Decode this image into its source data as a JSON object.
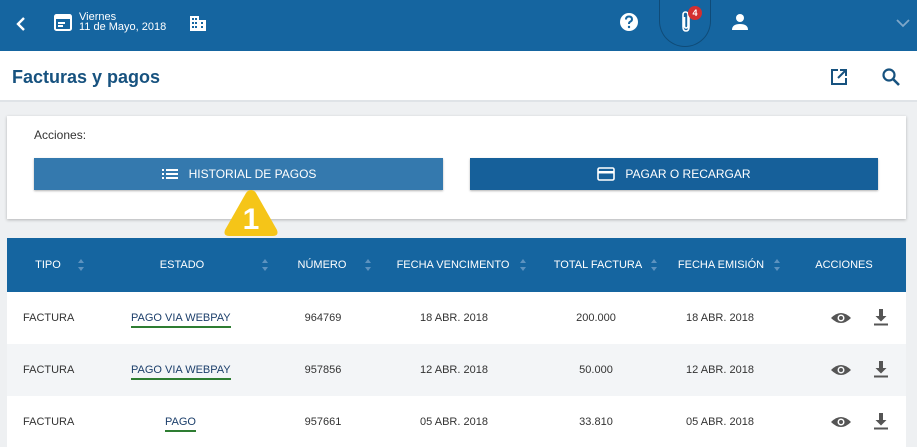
{
  "topbar": {
    "date_weekday": "Viernes",
    "date_full": "11 de Mayo, 2018",
    "notification_count": "4"
  },
  "header": {
    "title": "Facturas y pagos"
  },
  "actions": {
    "label": "Acciones:",
    "history_button": "HISTORIAL DE PAGOS",
    "pay_button": "PAGAR O RECARGAR"
  },
  "annotation": {
    "marker_number": "1",
    "marker_color": "#f5c518"
  },
  "table": {
    "headers": [
      "TIPO",
      "ESTADO",
      "NÚMERO",
      "FECHA VENCIMENTO",
      "TOTAL FACTURA",
      "FECHA EMISIÓN",
      "ACCIONES"
    ],
    "rows": [
      {
        "tipo": "FACTURA",
        "estado": "PAGO VIA WEBPAY",
        "numero": "964769",
        "vencimiento": "18 ABR. 2018",
        "total": "200.000",
        "emision": "18 ABR. 2018"
      },
      {
        "tipo": "FACTURA",
        "estado": "PAGO VIA WEBPAY",
        "numero": "957856",
        "vencimiento": "12 ABR. 2018",
        "total": "50.000",
        "emision": "12 ABR. 2018"
      },
      {
        "tipo": "FACTURA",
        "estado": "PAGO",
        "numero": "957661",
        "vencimiento": "05 ABR. 2018",
        "total": "33.810",
        "emision": "05 ABR. 2018"
      }
    ]
  },
  "colors": {
    "primary": "#1565a0",
    "status_underline": "#2e7d32",
    "title": "#17527f"
  }
}
